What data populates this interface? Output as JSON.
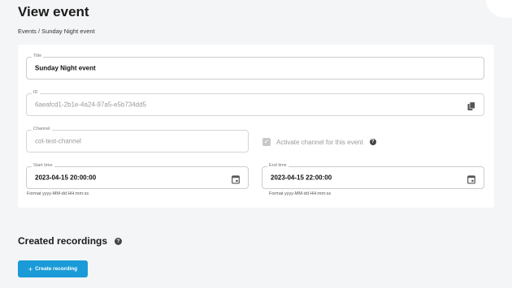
{
  "page": {
    "title": "View event",
    "breadcrumb": "Events / Sunday Night event"
  },
  "form": {
    "title": {
      "label": "Title",
      "value": "Sunday Night event"
    },
    "id": {
      "label": "ID",
      "value": "6aeafcd1-2b1e-4a24-97a5-e5b734dd5",
      "icon": "copy-icon"
    },
    "channel": {
      "label": "Channel",
      "value": "cot-test-channel"
    },
    "activate_channel": {
      "label": "Activate channel for this event",
      "checked": true,
      "disabled": true
    },
    "start_time": {
      "label": "Start time",
      "value": "2023-04-15 20:00:00",
      "helper": "Format yyyy-MM-dd HH:mm:ss",
      "icon": "calendar-icon"
    },
    "end_time": {
      "label": "End time",
      "value": "2023-04-15 22:00:00",
      "helper": "Format yyyy-MM-dd HH:mm:ss",
      "icon": "calendar-icon"
    }
  },
  "recordings": {
    "title": "Created recordings",
    "create_button": "Create recording",
    "create_icon": "+",
    "help_icon": "?"
  },
  "colors": {
    "accent": "#1a9bd7",
    "background": "#f4f5f7",
    "border": "#c9ccd1"
  }
}
